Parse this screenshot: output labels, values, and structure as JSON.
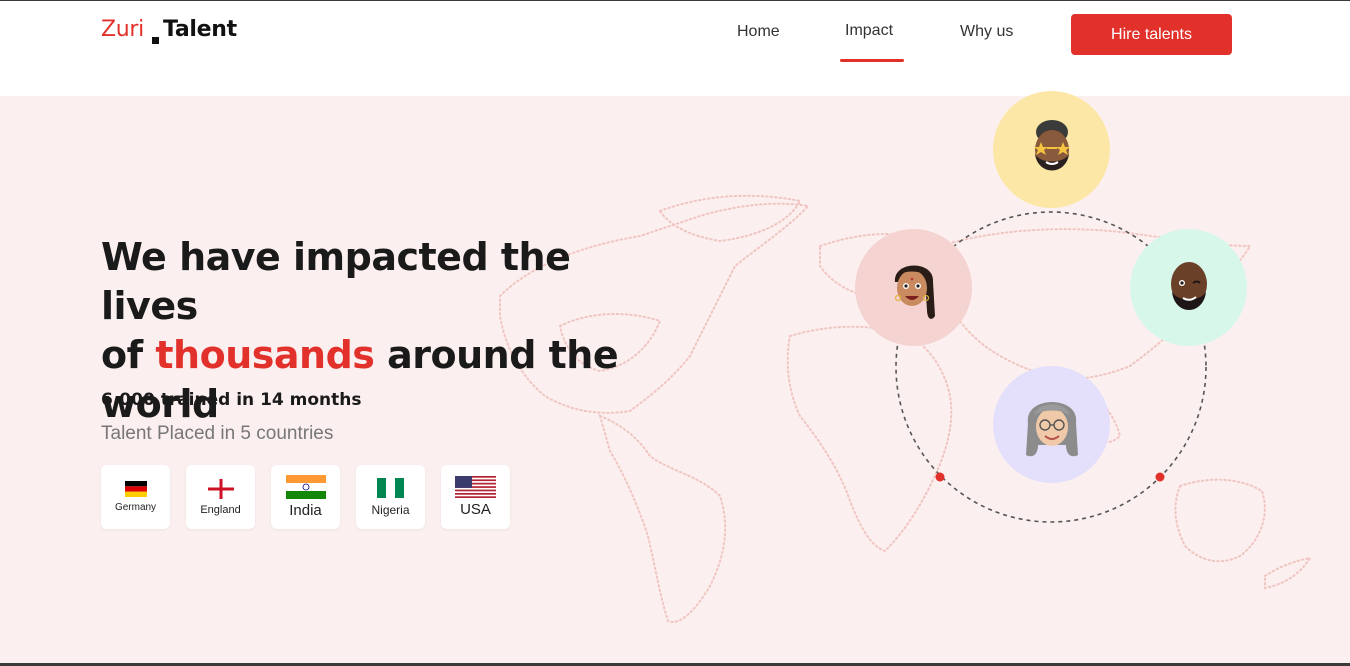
{
  "header": {
    "logo": {
      "part1": "Zuri",
      "part2": "Talent"
    },
    "nav": [
      {
        "label": "Home"
      },
      {
        "label": "Impact",
        "active": true
      },
      {
        "label": "Why us"
      }
    ],
    "cta_label": "Hire talents"
  },
  "hero": {
    "headline": {
      "line1": "We have impacted the lives",
      "line2_pre": "of ",
      "line2_accent": "thousands",
      "line2_post": " around the",
      "line3": "world"
    },
    "stat": "6,000 trained in 14 months",
    "placed": "Talent Placed in 5 countries",
    "countries": [
      {
        "label": "Germany",
        "flag": "germany-flag-icon"
      },
      {
        "label": "England",
        "flag": "england-flag-icon"
      },
      {
        "label": "India",
        "flag": "india-flag-icon"
      },
      {
        "label": "Nigeria",
        "flag": "nigeria-flag-icon"
      },
      {
        "label": "USA",
        "flag": "usa-flag-icon"
      }
    ],
    "avatars": [
      "avatar-star-glasses",
      "avatar-braid-woman",
      "avatar-wink-man",
      "avatar-grey-hair-woman"
    ]
  },
  "colors": {
    "accent": "#e2312a",
    "hero_bg": "#fbf0ef",
    "avatar_yellow": "#fde7a7",
    "avatar_pink": "#f4d3d1",
    "avatar_mint": "#d7f7ea",
    "avatar_lavender": "#e4e0fb"
  }
}
